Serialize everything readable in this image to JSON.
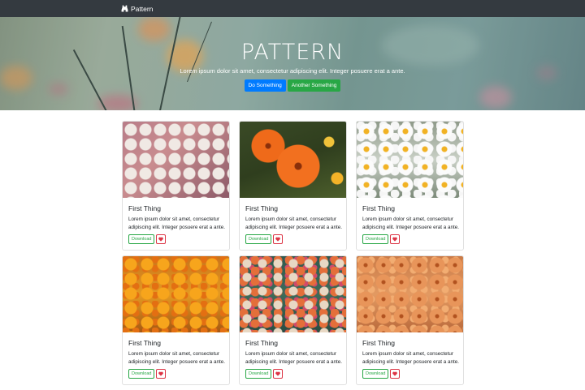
{
  "navbar": {
    "brand": "Pattern",
    "brand_icon": "binoculars-icon"
  },
  "hero": {
    "title": "PATTERN",
    "lead": "Lorem ipsum dolor sit amet, consectetur adipiscing elit. Integer posuere erat a ante.",
    "primary_button": "Do Something",
    "secondary_button": "Another Something"
  },
  "cards": [
    {
      "title": "First Thing",
      "text": "Lorem ipsum dolor sit amet, consectetur adipiscing elit. Integer posuere erat a ante.",
      "download_label": "Download",
      "like_icon": "heart-icon"
    },
    {
      "title": "First Thing",
      "text": "Lorem ipsum dolor sit amet, consectetur adipiscing elit. Integer posuere erat a ante.",
      "download_label": "Download",
      "like_icon": "heart-icon"
    },
    {
      "title": "First Thing",
      "text": "Lorem ipsum dolor sit amet, consectetur adipiscing elit. Integer posuere erat a ante.",
      "download_label": "Download",
      "like_icon": "heart-icon"
    },
    {
      "title": "First Thing",
      "text": "Lorem ipsum dolor sit amet, consectetur adipiscing elit. Integer posuere erat a ante.",
      "download_label": "Download",
      "like_icon": "heart-icon"
    },
    {
      "title": "First Thing",
      "text": "Lorem ipsum dolor sit amet, consectetur adipiscing elit. Integer posuere erat a ante.",
      "download_label": "Download",
      "like_icon": "heart-icon"
    },
    {
      "title": "First Thing",
      "text": "Lorem ipsum dolor sit amet, consectetur adipiscing elit. Integer posuere erat a ante.",
      "download_label": "Download",
      "like_icon": "heart-icon"
    }
  ],
  "colors": {
    "navbar": "#343a40",
    "primary": "#007bff",
    "success": "#28a745",
    "danger": "#dc3545"
  }
}
